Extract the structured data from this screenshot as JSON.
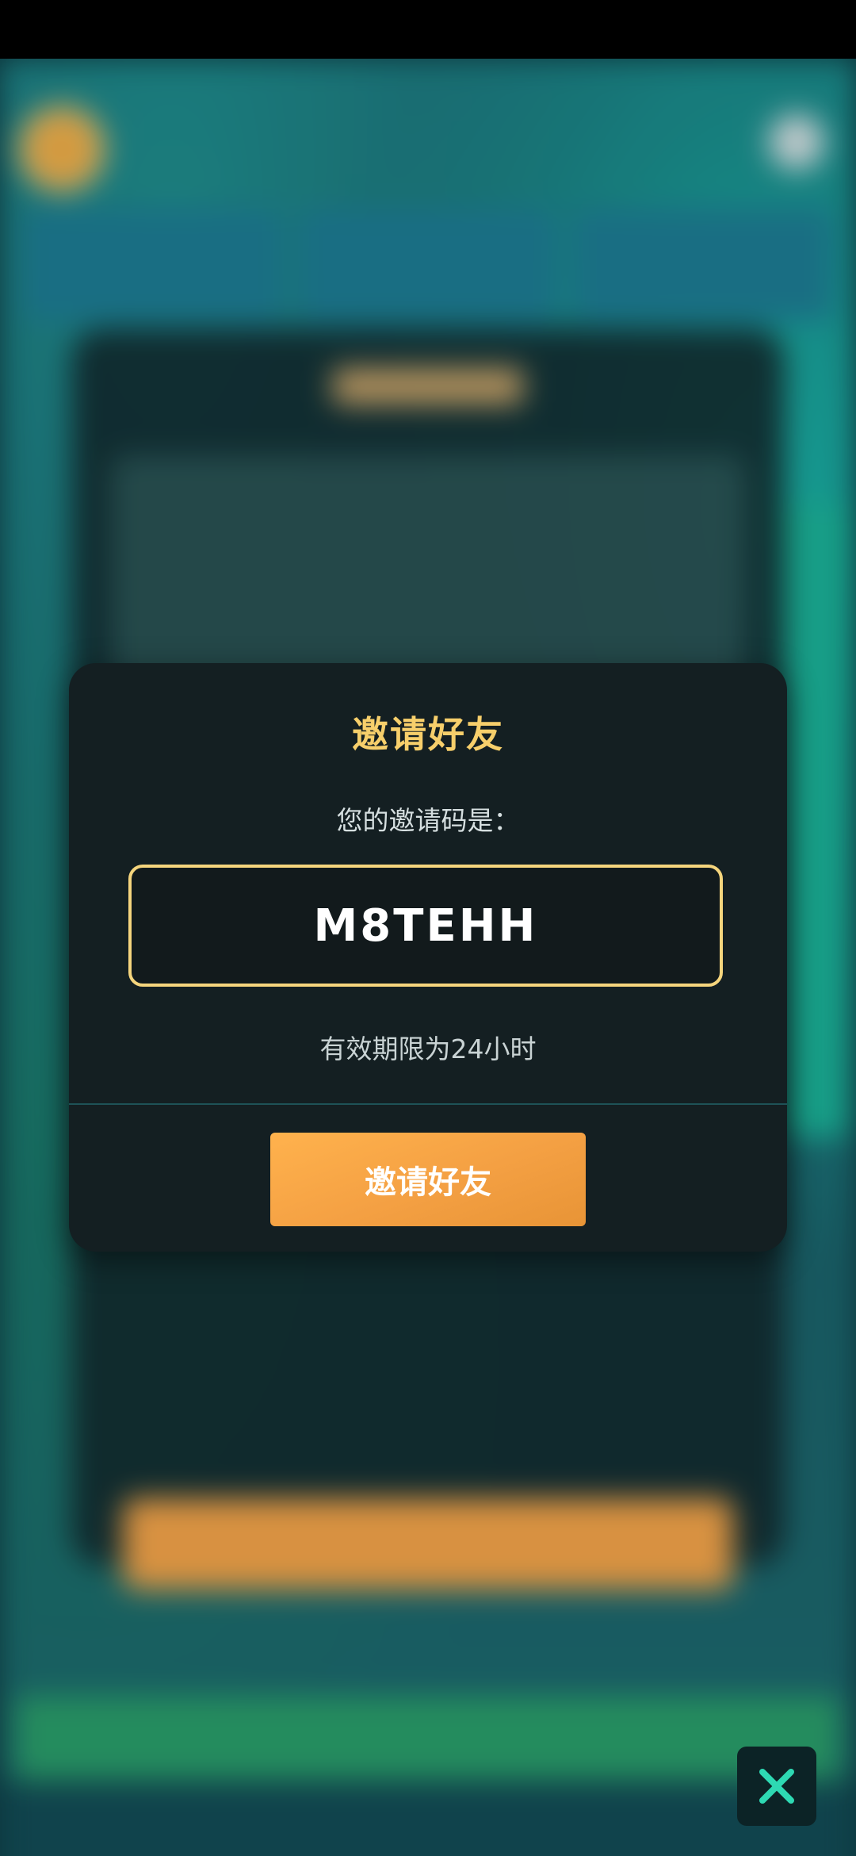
{
  "modal": {
    "title": "邀请好友",
    "label": "您的邀请码是：",
    "invite_code": "M8TEHH",
    "validity": "有效期限为24小时",
    "invite_button": "邀请好友"
  },
  "colors": {
    "accent_gold": "#f7cf6b",
    "button_orange": "#f4a043",
    "modal_bg": "#141f22",
    "close_icon": "#2ed9b3"
  },
  "icons": {
    "close": "close-icon"
  }
}
